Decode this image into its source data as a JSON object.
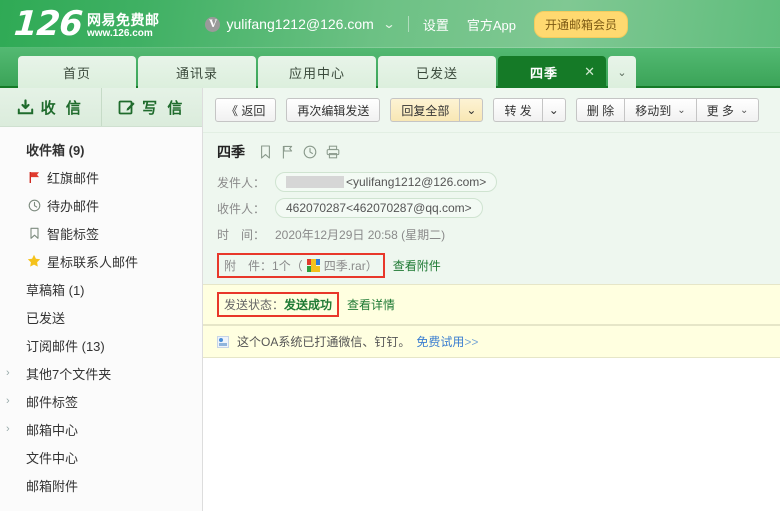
{
  "header": {
    "logo_number": "126",
    "logo_cn": "网易免费邮",
    "logo_url": "www.126.com",
    "avatar_letter": "V",
    "user_email": "yulifang1212@126.com",
    "caret": "⌄",
    "settings_label": "设置",
    "app_label": "官方App",
    "vip_label": "开通邮箱会员"
  },
  "tabs": [
    {
      "label": "首页",
      "active": false
    },
    {
      "label": "通讯录",
      "active": false
    },
    {
      "label": "应用中心",
      "active": false
    },
    {
      "label": "已发送",
      "active": false
    },
    {
      "label": "四季",
      "active": true,
      "close": "✕"
    }
  ],
  "tab_dropdown_icon": "⌄",
  "sidebar": {
    "receive_label": "收 信",
    "compose_label": "写 信",
    "receive_icon": "inbox-download-icon",
    "compose_icon": "compose-pencil-icon",
    "folders": [
      {
        "label": "收件箱 (9)",
        "icon": "",
        "indent": false,
        "arrow": false,
        "bold": true
      },
      {
        "label": "红旗邮件",
        "icon": "red-flag-icon",
        "indent": true,
        "arrow": false,
        "bold": false
      },
      {
        "label": "待办邮件",
        "icon": "clock-icon",
        "indent": true,
        "arrow": false,
        "bold": false
      },
      {
        "label": "智能标签",
        "icon": "bookmark-icon",
        "indent": true,
        "arrow": false,
        "bold": false
      },
      {
        "label": "星标联系人邮件",
        "icon": "star-icon",
        "indent": true,
        "arrow": false,
        "bold": false
      },
      {
        "label": "草稿箱 (1)",
        "icon": "",
        "indent": false,
        "arrow": false,
        "bold": false
      },
      {
        "label": "已发送",
        "icon": "",
        "indent": false,
        "arrow": false,
        "bold": false
      },
      {
        "label": "订阅邮件 (13)",
        "icon": "",
        "indent": false,
        "arrow": false,
        "bold": false
      },
      {
        "label": "其他7个文件夹",
        "icon": "",
        "indent": false,
        "arrow": true,
        "bold": false
      },
      {
        "label": "邮件标签",
        "icon": "",
        "indent": false,
        "arrow": true,
        "bold": false
      },
      {
        "label": "邮箱中心",
        "icon": "",
        "indent": false,
        "arrow": true,
        "bold": false
      },
      {
        "label": "文件中心",
        "icon": "",
        "indent": false,
        "arrow": false,
        "bold": false
      },
      {
        "label": "邮箱附件",
        "icon": "",
        "indent": false,
        "arrow": false,
        "bold": false
      }
    ]
  },
  "toolbar": {
    "back_label": "《 返回",
    "reedit_label": "再次编辑发送",
    "reply_all_label": "回复全部",
    "reply_all_caret": "⌄",
    "forward_label": "转 发",
    "forward_caret": "⌄",
    "delete_label": "删 除",
    "move_to_label": "移动到",
    "move_to_caret": "⌄",
    "more_label": "更 多",
    "more_caret": "⌄"
  },
  "mail": {
    "subject": "四季",
    "subject_icons": [
      "bookmark-icon",
      "flag-icon",
      "clock-icon",
      "printer-icon"
    ],
    "from_label": "发件人：",
    "from_redacted": true,
    "from_value": "<yulifang1212@126.com>",
    "to_label": "收件人：",
    "to_value": "462070287<462070287@qq.com>",
    "time_label": "时　间：",
    "time_value": "2020年12月29日 20:58 (星期二)",
    "attach_label": "附　件：",
    "attach_count_text": "1个（",
    "attach_file": "四季.rar",
    "attach_close_paren": "）",
    "attach_view_link": "查看附件",
    "status_label": "发送状态：",
    "status_value": "发送成功",
    "status_detail_link": "查看详情",
    "ad_text": "这个OA系统已打通微信、钉钉。",
    "ad_link": "免费试用",
    "ad_link_suffix": ">>"
  },
  "colors": {
    "header_green": "#4fb56e",
    "active_tab_green": "#157a27",
    "mail_header_bg": "#eef7ef",
    "yellow_strip": "#ffffe0",
    "annotation_red": "#e8372a",
    "vip_yellow": "#ffd970",
    "link_green": "#1f7a34",
    "link_blue": "#3b7ed0"
  }
}
